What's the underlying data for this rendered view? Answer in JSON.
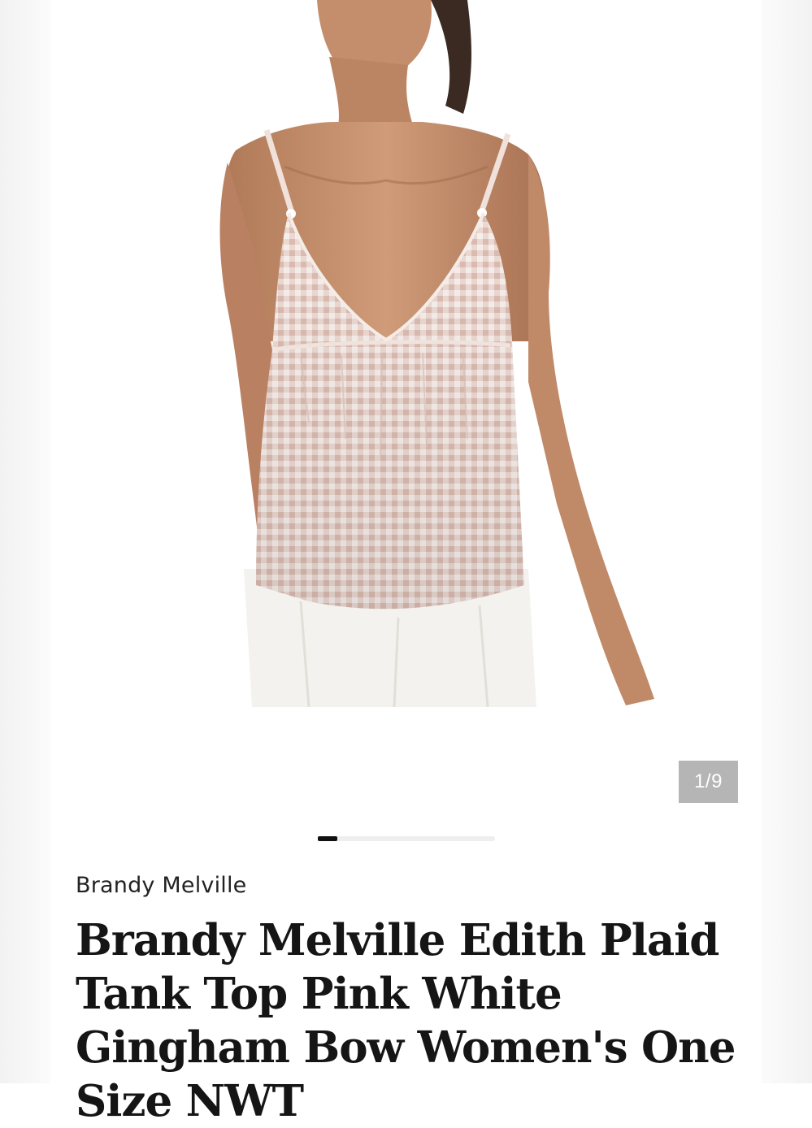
{
  "gallery": {
    "counter": "1/9",
    "current_index": 1,
    "total_images": 9,
    "progress_fraction": 0.111
  },
  "product": {
    "brand": "Brandy Melville",
    "title": "Brandy Melville Edith Plaid Tank Top Pink White Gingham Bow Women's One Size NWT"
  },
  "colors": {
    "background": "#ffffff",
    "counter_bg": "#b5b5b5",
    "progress_active": "#111111",
    "progress_track": "#eeeeee",
    "gingham_pink": "#e8cfc8",
    "skin": "#c99572"
  },
  "icons": {
    "product_image": "product-photo-icon"
  }
}
